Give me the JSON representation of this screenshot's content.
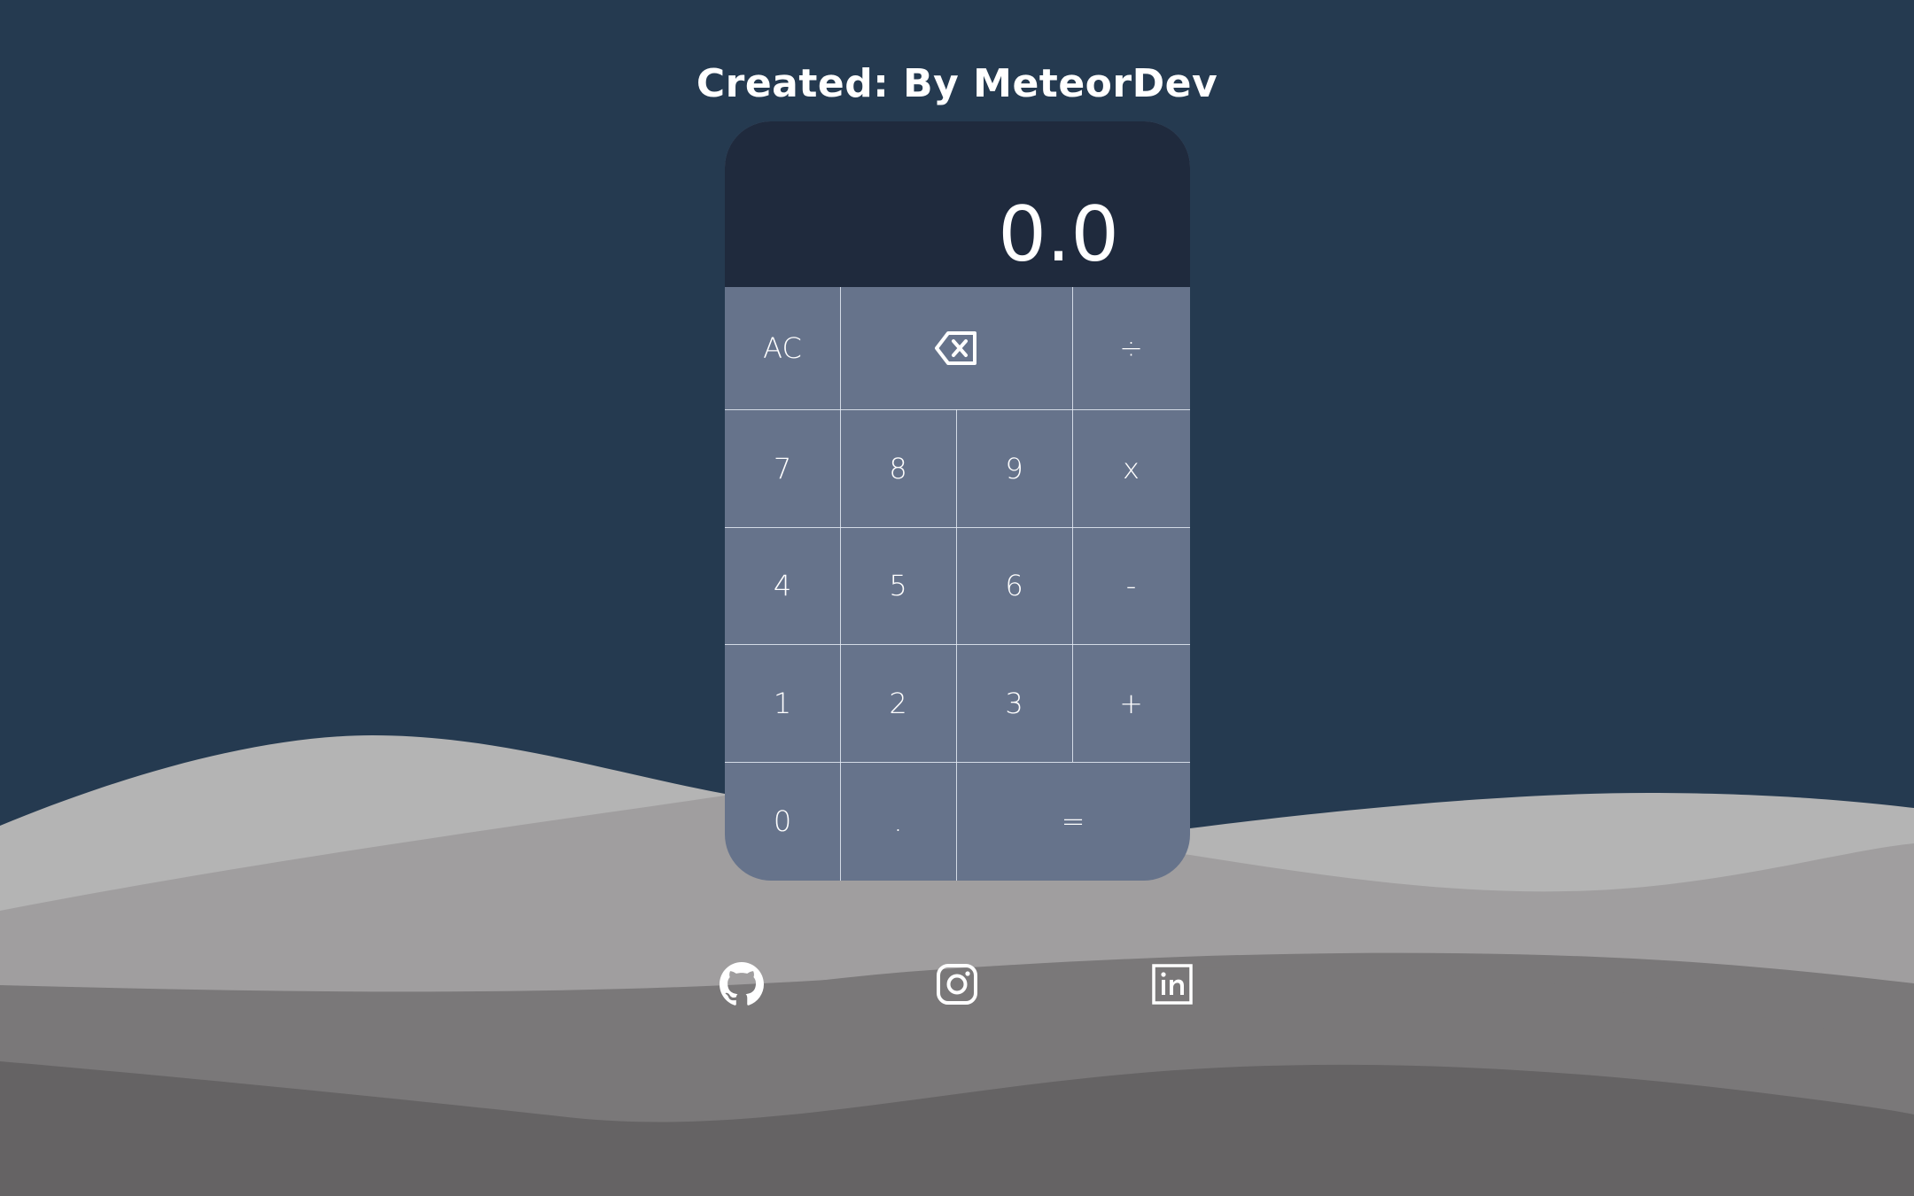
{
  "header": {
    "title": "Created: By MeteorDev"
  },
  "calculator": {
    "display_value": "0.0",
    "keys": {
      "clear": "AC",
      "backspace_icon": "backspace-icon",
      "divide": "÷",
      "seven": "7",
      "eight": "8",
      "nine": "9",
      "multiply": "x",
      "four": "4",
      "five": "5",
      "six": "6",
      "subtract": "-",
      "one": "1",
      "two": "2",
      "three": "3",
      "add": "+",
      "zero": "0",
      "decimal": ".",
      "equals": "="
    }
  },
  "social_links": [
    {
      "icon": "github-icon"
    },
    {
      "icon": "instagram-icon"
    },
    {
      "icon": "linkedin-icon"
    }
  ],
  "colors": {
    "background": "#253a50",
    "display_background": "#1f2a3d",
    "keypad_background": "#66738b",
    "wave_light": "#b4b4b4",
    "wave_mid": "#a09e9f",
    "wave_dark": "#7a7879",
    "wave_darkest": "#656364",
    "text": "#ffffff"
  }
}
